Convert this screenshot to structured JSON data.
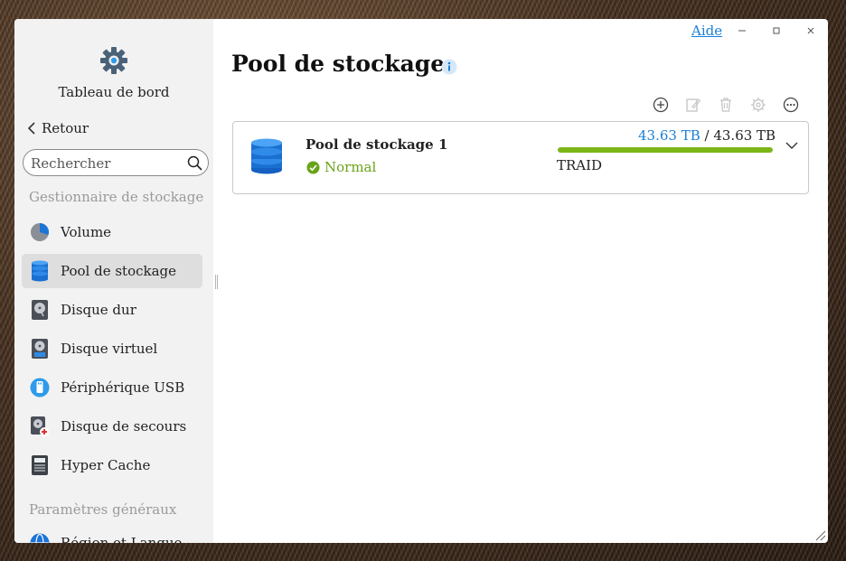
{
  "window": {
    "help_label": "Aide",
    "minimize_icon": "minimize-icon",
    "maximize_icon": "maximize-icon",
    "close_icon": "close-icon"
  },
  "sidebar": {
    "dashboard_label": "Tableau de bord",
    "back_label": "Retour",
    "search_placeholder": "Rechercher",
    "section_storage": "Gestionnaire de stockage",
    "items": [
      {
        "label": "Volume",
        "icon": "pie-volume-icon"
      },
      {
        "label": "Pool de stockage",
        "icon": "database-icon",
        "active": true
      },
      {
        "label": "Disque dur",
        "icon": "hard-disk-icon"
      },
      {
        "label": "Disque virtuel",
        "icon": "virtual-disk-icon"
      },
      {
        "label": "Périphérique USB",
        "icon": "usb-icon"
      },
      {
        "label": "Disque de secours",
        "icon": "spare-disk-icon"
      },
      {
        "label": "Hyper Cache",
        "icon": "cache-icon"
      }
    ],
    "section_general": "Paramètres généraux",
    "partial_item": {
      "label": "Région et Langue",
      "icon": "globe-icon"
    }
  },
  "main": {
    "title": "Pool de stockage",
    "toolbar_icons": [
      "add-icon",
      "edit-icon",
      "delete-icon",
      "settings-icon",
      "more-icon"
    ],
    "pool": {
      "name": "Pool de stockage 1",
      "status": "Normal",
      "used": "43.63 TB",
      "separator": " / ",
      "total": "43.63 TB",
      "usage_fraction": 1.0,
      "raid": "TRAID"
    }
  },
  "colors": {
    "accent": "#1a7fd4",
    "status_ok": "#6aa31a",
    "bar_fill": "#7cb518"
  }
}
